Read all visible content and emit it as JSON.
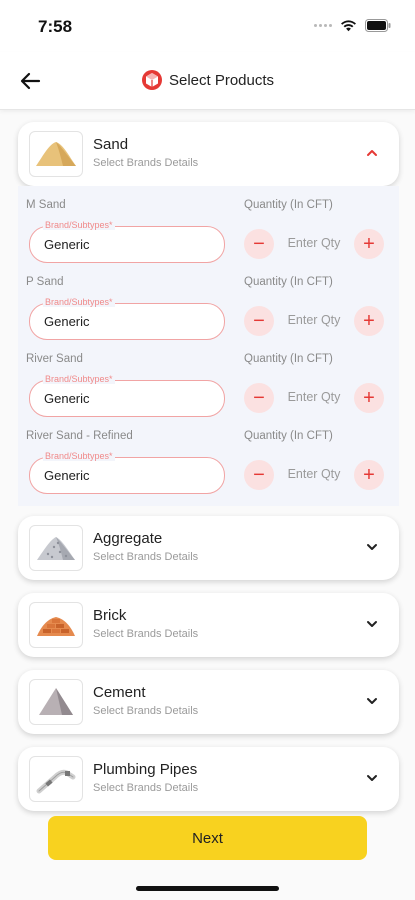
{
  "status_bar": {
    "time": "7:58"
  },
  "header": {
    "title": "Select Products"
  },
  "colors": {
    "accent": "#e53935",
    "next_button": "#f8d21f",
    "panel_bg": "#f3f5fb"
  },
  "expanded_product": {
    "name": "Sand",
    "subtitle": "Select Brands Details",
    "rows": [
      {
        "label": "M Sand",
        "qty_label": "Quantity (In CFT)",
        "brand_legend": "Brand/Subtypes*",
        "brand_value": "Generic",
        "qty_placeholder": "Enter Qty"
      },
      {
        "label": "P Sand",
        "qty_label": "Quantity (In CFT)",
        "brand_legend": "Brand/Subtypes*",
        "brand_value": "Generic",
        "qty_placeholder": "Enter Qty"
      },
      {
        "label": "River Sand",
        "qty_label": "Quantity (In CFT)",
        "brand_legend": "Brand/Subtypes*",
        "brand_value": "Generic",
        "qty_placeholder": "Enter Qty"
      },
      {
        "label": "River Sand - Refined",
        "qty_label": "Quantity (In CFT)",
        "brand_legend": "Brand/Subtypes*",
        "brand_value": "Generic",
        "qty_placeholder": "Enter Qty"
      }
    ]
  },
  "collapsed_products": [
    {
      "name": "Aggregate",
      "subtitle": "Select Brands Details",
      "icon": "aggregate-icon"
    },
    {
      "name": "Brick",
      "subtitle": "Select Brands Details",
      "icon": "brick-icon"
    },
    {
      "name": "Cement",
      "subtitle": "Select Brands Details",
      "icon": "cement-icon"
    },
    {
      "name": "Plumbing Pipes",
      "subtitle": "Select Brands Details",
      "icon": "pipes-icon"
    }
  ],
  "footer": {
    "next_label": "Next"
  }
}
